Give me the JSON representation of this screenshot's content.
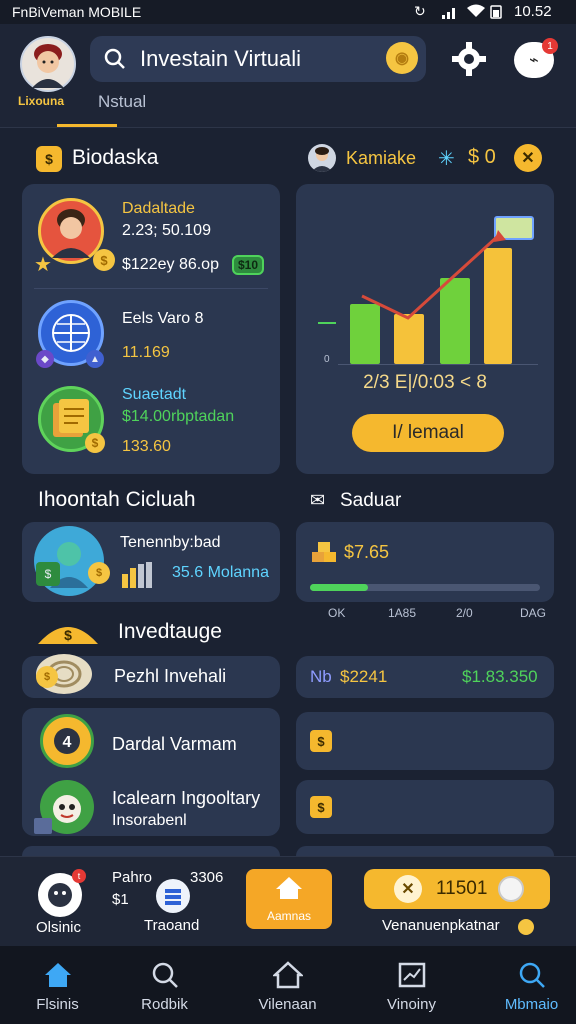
{
  "status_bar": {
    "carrier": "FnBiVeman MOBILE",
    "time": "10.52"
  },
  "header": {
    "username": "Lixouna",
    "tab_label": "Nstual",
    "search_value": "Investain Virtuali",
    "notification_count": "1"
  },
  "section1": {
    "title": "Biodaska",
    "items": [
      {
        "title": "Dadaltade",
        "line1": "2.23; 50.109",
        "line2": "$122ey 86.op",
        "badge": "$10"
      },
      {
        "title": "Eels Varo 8",
        "line1": "11.169"
      },
      {
        "title": "Suaetadt",
        "line1": "$14.00rbptadan",
        "line2": "133.60"
      }
    ]
  },
  "chart_panel": {
    "user_name": "Kamiake",
    "balance": "$ 0",
    "readout": "2/3 E|/0:03 < 8",
    "button_label": "I/ lemaal",
    "colors": {
      "green": "#6fd13c",
      "yellow": "#f5c23a",
      "line": "#d64a3a"
    }
  },
  "section2": {
    "title": "Ihoontah Cicluah",
    "card": {
      "title": "Tenennby:bad",
      "value": "35.6 Molanna"
    }
  },
  "sadua_panel": {
    "title": "Saduar",
    "amount": "$7.65",
    "progress": 0.25,
    "axis_labels": [
      "OK",
      "1A85",
      "2/0",
      "DAG"
    ]
  },
  "section3": {
    "title": "Invedtauge",
    "card_label": "Pezhl Invehali"
  },
  "values_row": {
    "left": "$2241",
    "left_prefix": "Nb",
    "right": "$1.83.350"
  },
  "section4": {
    "item1": "Dardal Varmam",
    "item2_title": "Icalearn Ingooltary",
    "item2_sub": "Insorabenl"
  },
  "bottom_cards": {
    "item1_label": "Olsinic",
    "item2_line1": "Pahro",
    "item2_line2": "$1",
    "item2_value": "3306",
    "item2_label": "Traoand",
    "center_button": "Aamnas",
    "coin_value": "11501",
    "right_label": "Venanuenpkatnar"
  },
  "bottom_nav": [
    {
      "label": "Flsinis",
      "icon": "home-icon"
    },
    {
      "label": "Rodbik",
      "icon": "search-icon"
    },
    {
      "label": "Vilenaan",
      "icon": "house-outline-icon"
    },
    {
      "label": "Vinoiny",
      "icon": "chart-icon"
    },
    {
      "label": "Mbmaio",
      "icon": "search-icon"
    }
  ]
}
